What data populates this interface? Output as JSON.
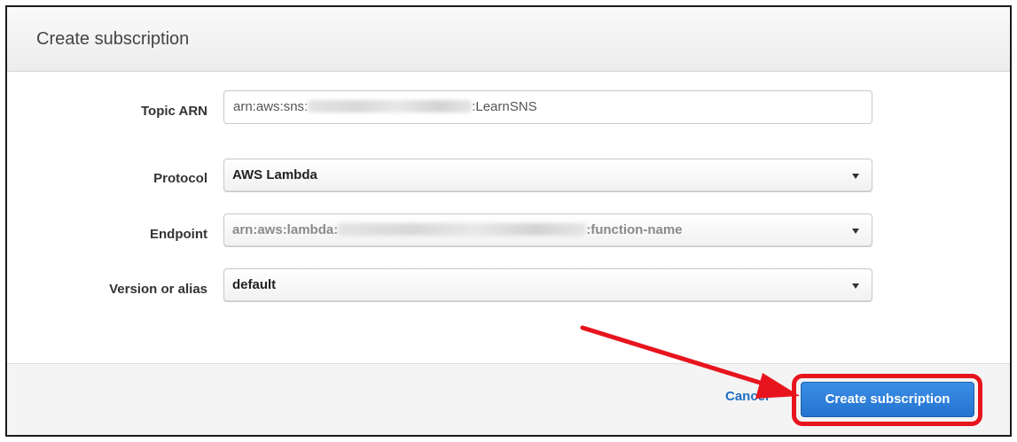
{
  "dialog": {
    "title": "Create subscription"
  },
  "form": {
    "topic_arn": {
      "label": "Topic ARN",
      "value_prefix": "arn:aws:sns:",
      "value_suffix": ":LearnSNS"
    },
    "protocol": {
      "label": "Protocol",
      "selected": "AWS Lambda"
    },
    "endpoint": {
      "label": "Endpoint",
      "value_prefix": "arn:aws:lambda:",
      "value_suffix": ":function-name"
    },
    "version_alias": {
      "label": "Version or alias",
      "selected": "default"
    }
  },
  "footer": {
    "cancel_label": "Cancel",
    "create_label": "Create subscription"
  },
  "annotation": {
    "color": "#e8141d",
    "accent_button_color": "#2574cf",
    "link_color": "#1f6fc2"
  }
}
